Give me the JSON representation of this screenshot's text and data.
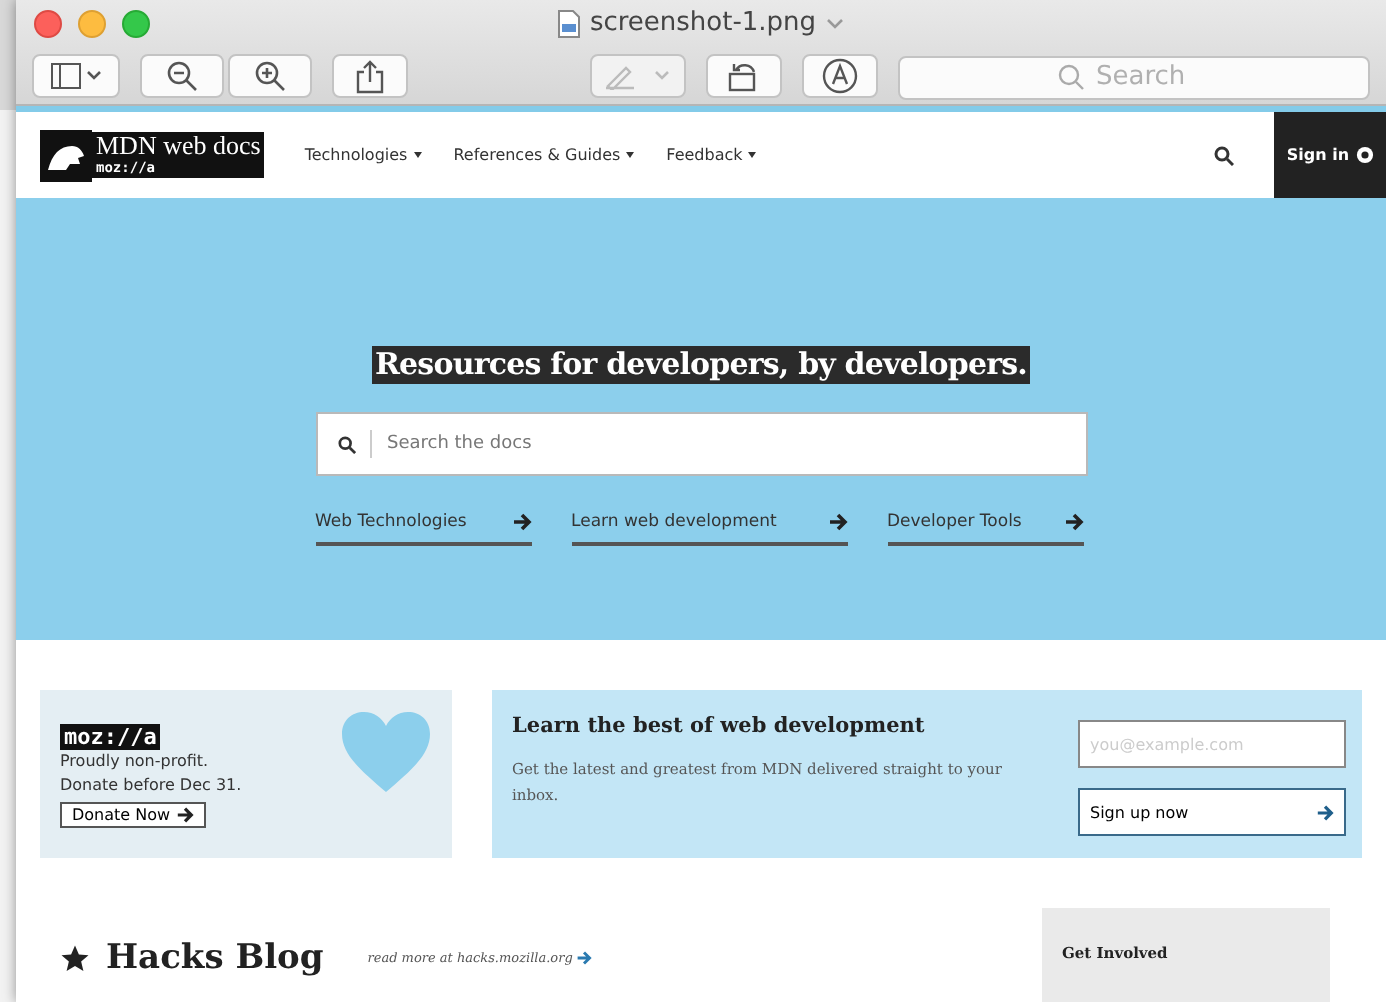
{
  "window": {
    "title": "screenshot-1.png",
    "search_placeholder": "Search"
  },
  "header": {
    "logo_text": "MDN web docs",
    "logo_sub": "moz://a",
    "nav": [
      "Technologies",
      "References & Guides",
      "Feedback"
    ],
    "sign_in": "Sign in"
  },
  "hero": {
    "heading": "Resources for developers, by developers.",
    "search_placeholder": "Search the docs",
    "links": [
      "Web Technologies",
      "Learn web development",
      "Developer Tools"
    ]
  },
  "donate": {
    "logo": "moz://a",
    "lines": [
      "Proudly non-profit.",
      "Donate before Dec 31."
    ],
    "button": "Donate Now"
  },
  "newsletter": {
    "title": "Learn the best of web development",
    "text": "Get the latest and greatest from MDN delivered straight to your inbox.",
    "email_placeholder": "you@example.com",
    "button": "Sign up now"
  },
  "blog": {
    "title": "Hacks Blog",
    "link": "read more at hacks.mozilla.org"
  },
  "sidebar": {
    "title": "Get Involved"
  }
}
